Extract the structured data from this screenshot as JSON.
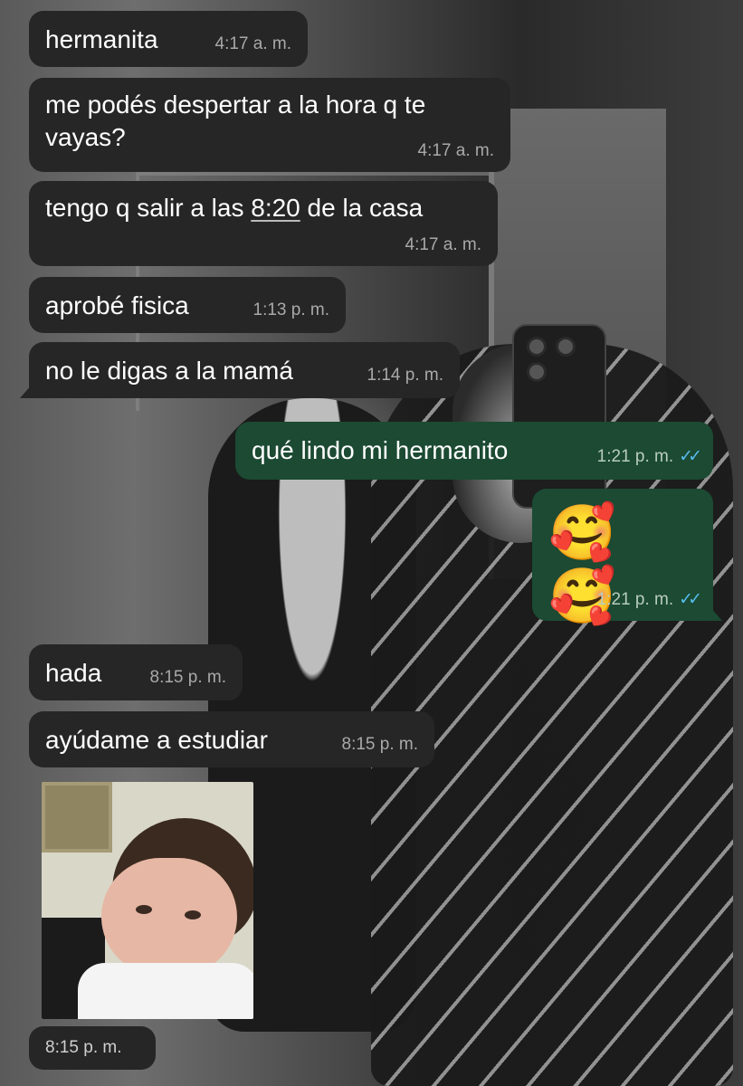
{
  "messages": [
    {
      "text": "hermanita",
      "time": "4:17 a. m."
    },
    {
      "text": "me podés despertar a la hora q te vayas?",
      "time": "4:17 a. m."
    },
    {
      "text_before": "tengo q salir a las ",
      "text_link": "8:20",
      "text_after": " de la casa",
      "time": "4:17 a. m."
    },
    {
      "text": "aprobé fisica",
      "time": "1:13 p. m."
    },
    {
      "text": "no le digas a la mamá",
      "time": "1:14 p. m."
    },
    {
      "text": "qué lindo mi hermanito",
      "time": "1:21 p. m.",
      "status": "✓✓"
    },
    {
      "emoji": "🥰 🥰",
      "time": "1:21 p. m.",
      "status": "✓✓"
    },
    {
      "text": "hada",
      "time": "8:15 p. m."
    },
    {
      "text": "ayúdame a estudiar",
      "time": "8:15 p. m."
    },
    {
      "time": "8:15 p. m."
    }
  ],
  "colors": {
    "incoming_bubble": "#262626",
    "outgoing_bubble": "#1c4a33",
    "read_ticks": "#53bdeb",
    "timestamp": "#a9a9a9"
  },
  "icons": {
    "read_status": "double-check-icon"
  }
}
